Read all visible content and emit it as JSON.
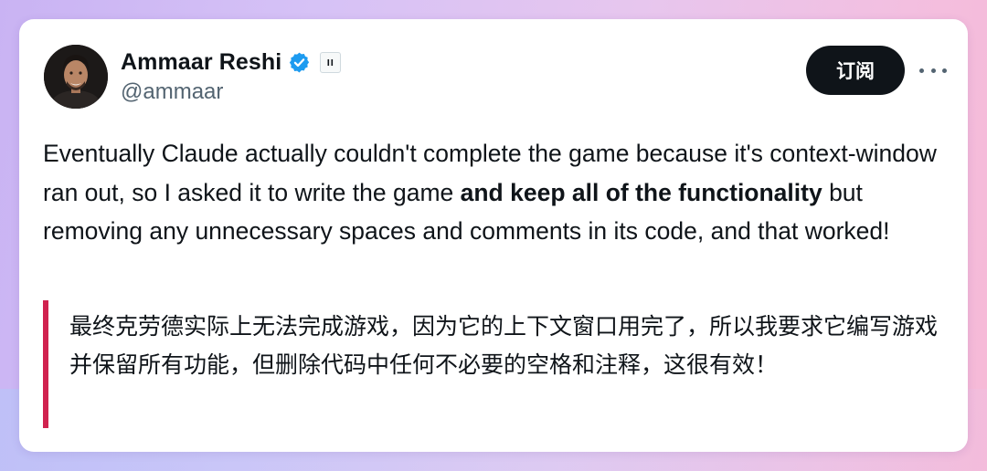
{
  "author": {
    "name": "Ammaar Reshi",
    "handle": "@ammaar",
    "verified": true
  },
  "actions": {
    "subscribe_label": "订阅",
    "more_icon": "ellipsis-icon"
  },
  "tweet": {
    "text_part1": "Eventually Claude actually couldn't complete the game because it's context-window ran out, so I asked it to write the game ",
    "text_bold": "and keep all of the functionality",
    "text_part2": " but removing any unnecessary spaces and comments in its code, and that worked!"
  },
  "translation": {
    "text": "最终克劳德实际上无法完成游戏，因为它的上下文窗口用完了，所以我要求它编写游戏并保留所有功能，但删除代码中任何不必要的空格和注释，这很有效！",
    "accent_color": "#d0224f"
  },
  "colors": {
    "verified_blue": "#1d9bf0",
    "button_bg": "#0f1419"
  }
}
